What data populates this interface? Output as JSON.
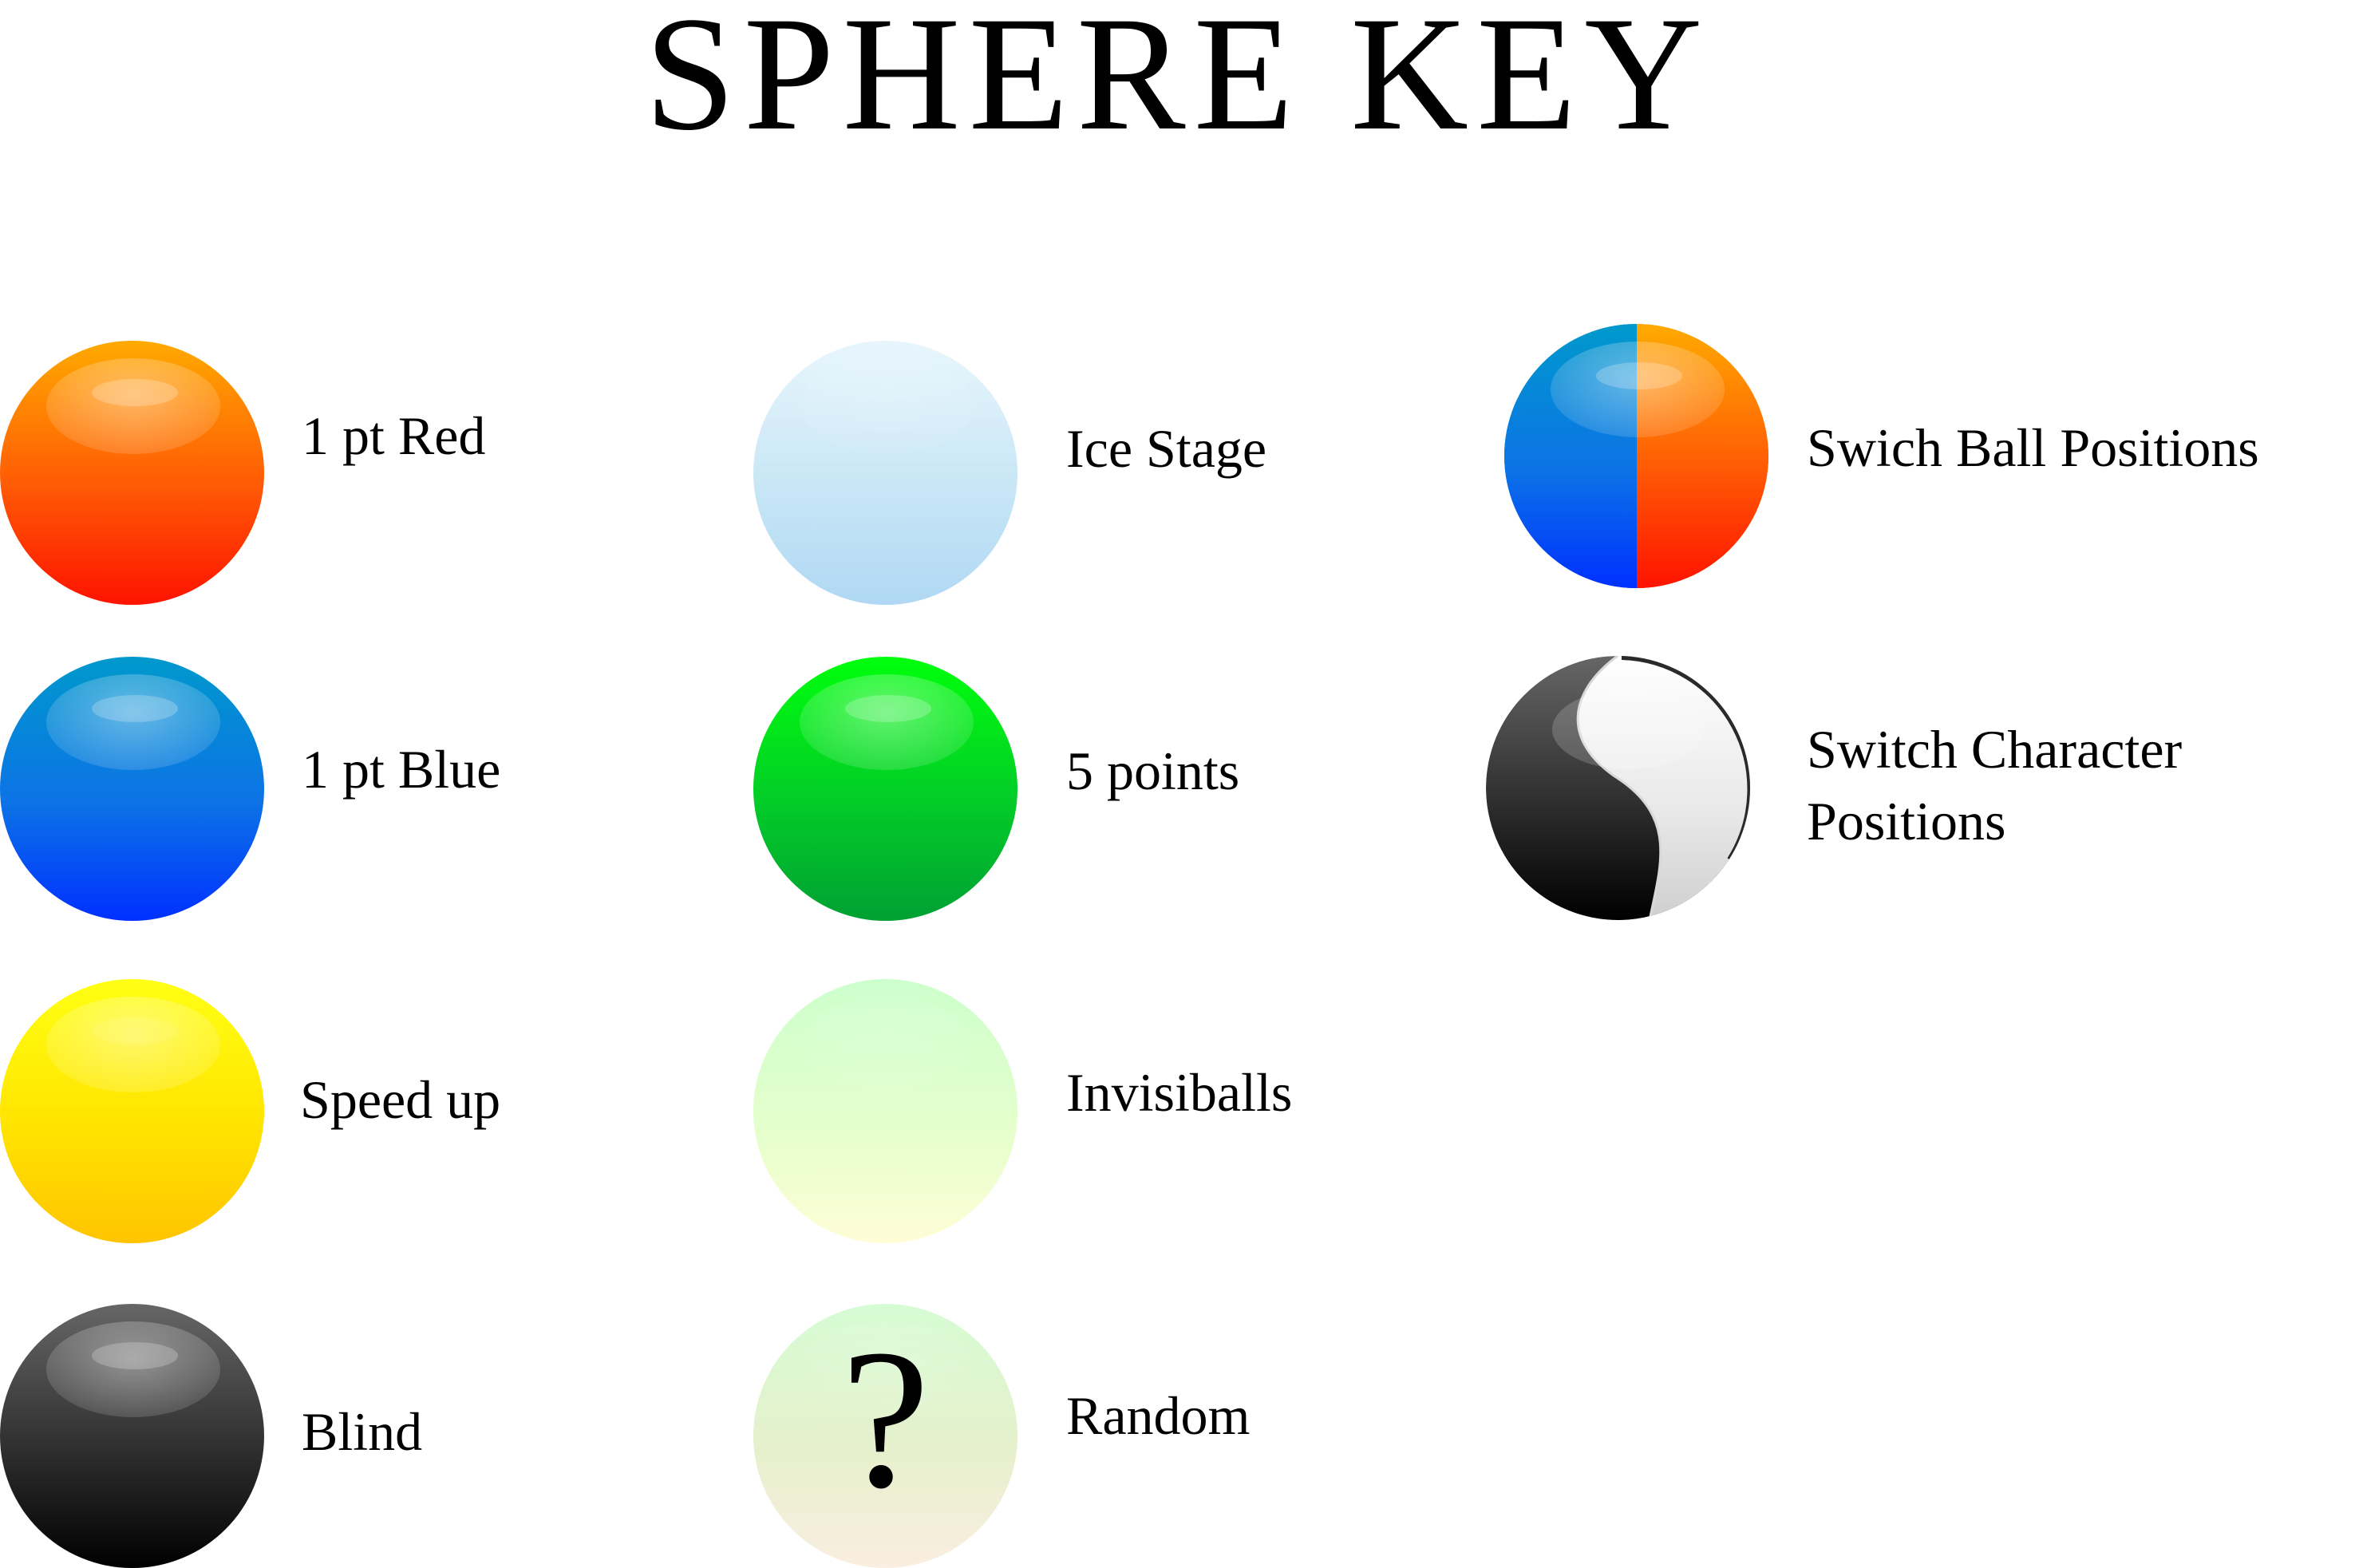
{
  "title": "SPHERE KEY",
  "items": [
    {
      "label": "1 pt Red",
      "icon": "red-sphere-icon"
    },
    {
      "label": "1 pt Blue",
      "icon": "blue-sphere-icon"
    },
    {
      "label": "Speed up",
      "icon": "yellow-sphere-icon"
    },
    {
      "label": "Blind",
      "icon": "black-sphere-icon"
    },
    {
      "label": "Ice Stage",
      "icon": "ice-sphere-icon"
    },
    {
      "label": "5 points",
      "icon": "green-sphere-icon"
    },
    {
      "label": "Invisiballs",
      "icon": "pale-green-sphere-icon"
    },
    {
      "label": "Random",
      "icon": "question-sphere-icon",
      "symbol": "?"
    },
    {
      "label": "Swich Ball Positions",
      "icon": "split-blue-orange-sphere-icon"
    },
    {
      "label_line1": "Switch Character",
      "label_line2": "Positions",
      "icon": "black-white-swirl-sphere-icon"
    }
  ],
  "colors": {
    "red": "#ff3a00",
    "blue": "#0c73e6",
    "yellow": "#ffe400",
    "black": "#222222",
    "ice": "#c8e6f6",
    "green": "#03cc28",
    "invisible": "#e6ffcc",
    "random": "#e6f0cc"
  }
}
